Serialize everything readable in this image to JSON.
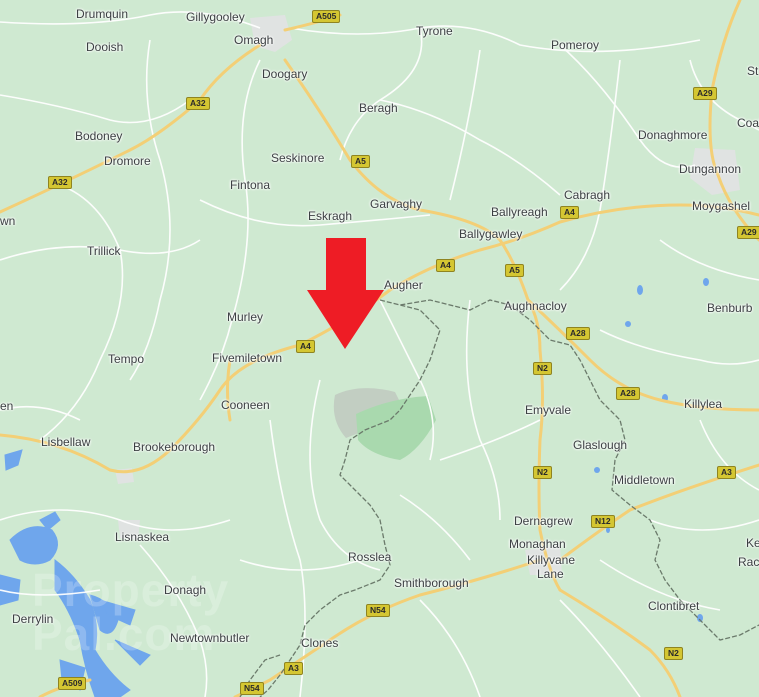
{
  "map": {
    "colors": {
      "land": "#cfe9d1",
      "road_major": "#f6d27a",
      "road_minor": "#ffffff",
      "water": "#6fa6ec",
      "border": "#6b7a6b",
      "forest": "#a9d9ae",
      "arrow": "#ee1c25"
    },
    "places": {
      "drumquin": "Drumquin",
      "gillygooley": "Gillygooley",
      "omagh": "Omagh",
      "tyrone": "Tyrone",
      "pomeroy": "Pomeroy",
      "dooish": "Dooish",
      "doogary": "Doogary",
      "beragh": "Beragh",
      "bodoney": "Bodoney",
      "donaghmore": "Donaghmore",
      "coal": "Coal",
      "dromore": "Dromore",
      "seskinore": "Seskinore",
      "dungannon": "Dungannon",
      "fintona": "Fintona",
      "cabragh": "Cabragh",
      "moygashel": "Moygashel",
      "garvaghy": "Garvaghy",
      "eskragh": "Eskragh",
      "ballyreagh": "Ballyreagh",
      "trillick": "Trillick",
      "ballygawley": "Ballygawley",
      "augher": "Augher",
      "aughnacloy": "Aughnacloy",
      "benburb": "Benburb",
      "murley": "Murley",
      "tempo": "Tempo",
      "fivemiletown": "Fivemiletown",
      "cooneen": "Cooneen",
      "emyvale": "Emyvale",
      "killylea": "Killylea",
      "lisbellaw": "Lisbellaw",
      "brookeborough": "Brookeborough",
      "glaslough": "Glaslough",
      "middletown": "Middletown",
      "lisnaskea": "Lisnaskea",
      "dernagrew": "Dernagrew",
      "monaghan": "Monaghan",
      "killyvane_lane_1": "Killyvane",
      "killyvane_lane_2": "Lane",
      "rosslea": "Rosslea",
      "smithborough": "Smithborough",
      "donagh": "Donagh",
      "derrylin": "Derrylin",
      "clontibret": "Clontibret",
      "newtownbutler": "Newtownbutler",
      "clones": "Clones",
      "edge_wn": "wn",
      "edge_en": "en",
      "edge_st": "St",
      "edge_ke": "Ke",
      "edge_rac": "Rac"
    },
    "roads": {
      "a505": "A505",
      "a32_north": "A32",
      "a32_west": "A32",
      "a5_north": "A5",
      "a5_south": "A5",
      "a29_north": "A29",
      "a29_east": "A29",
      "a4_east": "A4",
      "a4_mid": "A4",
      "a4_west": "A4",
      "a28_1": "A28",
      "a28_2": "A28",
      "n2_1": "N2",
      "n2_2": "N2",
      "n2_3": "N2",
      "n12": "N12",
      "a3_east": "A3",
      "n54": "N54",
      "a3_south": "A3",
      "n54_south": "N54",
      "a509": "A509"
    },
    "watermark": {
      "line1": "Property",
      "line2": "Pal.com"
    }
  }
}
